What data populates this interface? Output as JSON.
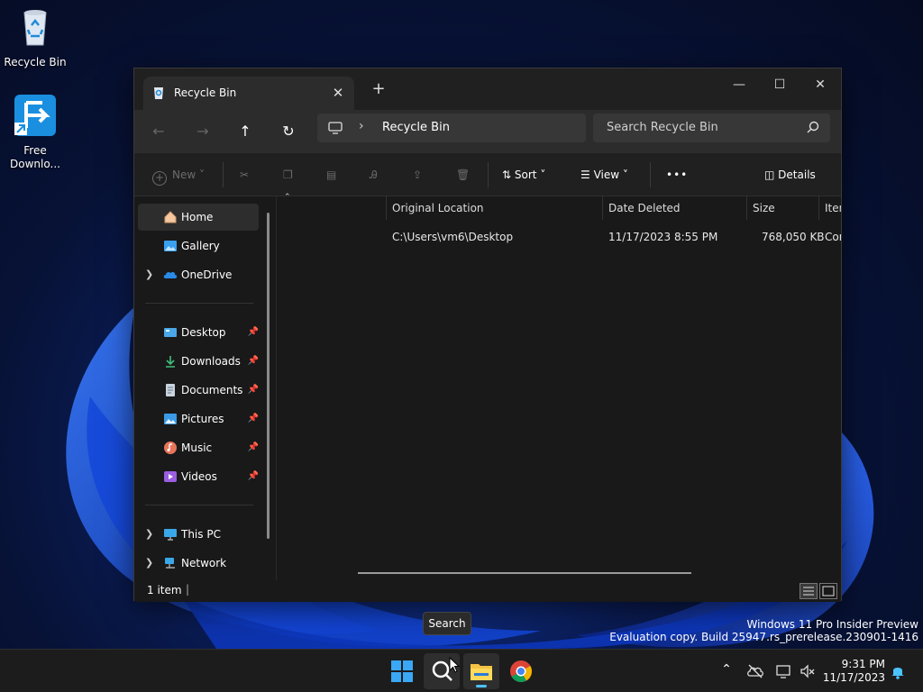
{
  "desktop": {
    "icons": [
      {
        "label": "Recycle Bin"
      },
      {
        "label": "Free Downlo..."
      }
    ]
  },
  "window": {
    "tab_title": "Recycle Bin",
    "controls": {
      "minimize": "—",
      "maximize": "☐",
      "close": "✕"
    },
    "address": {
      "crumb": "Recycle Bin"
    },
    "search": {
      "placeholder": "Search Recycle Bin"
    },
    "commands": {
      "new": "New",
      "sort": "Sort",
      "view": "View",
      "more": "•••",
      "details": "Details"
    },
    "nav": {
      "items": [
        {
          "label": "Home"
        },
        {
          "label": "Gallery"
        },
        {
          "label": "OneDrive"
        },
        {
          "label": "Desktop"
        },
        {
          "label": "Downloads"
        },
        {
          "label": "Documents"
        },
        {
          "label": "Pictures"
        },
        {
          "label": "Music"
        },
        {
          "label": "Videos"
        },
        {
          "label": "This PC"
        },
        {
          "label": "Network"
        }
      ]
    },
    "columns": [
      "Original Location",
      "Date Deleted",
      "Size",
      "Item"
    ],
    "rows": [
      {
        "location": "C:\\Users\\vm6\\Desktop",
        "date": "11/17/2023 8:55 PM",
        "size": "768,050 KB",
        "type": "Cor"
      }
    ],
    "status": "1 item"
  },
  "tooltip": "Search",
  "watermark": {
    "line1": "Windows 11 Pro Insider Preview",
    "line2": "Evaluation copy. Build 25947.rs_prerelease.230901-1416"
  },
  "clock": {
    "time": "9:31 PM",
    "date": "11/17/2023"
  },
  "colors": {
    "accent": "#4cc2ff",
    "window_bg": "#191919",
    "toolbar_bg": "#2c2c2c"
  }
}
